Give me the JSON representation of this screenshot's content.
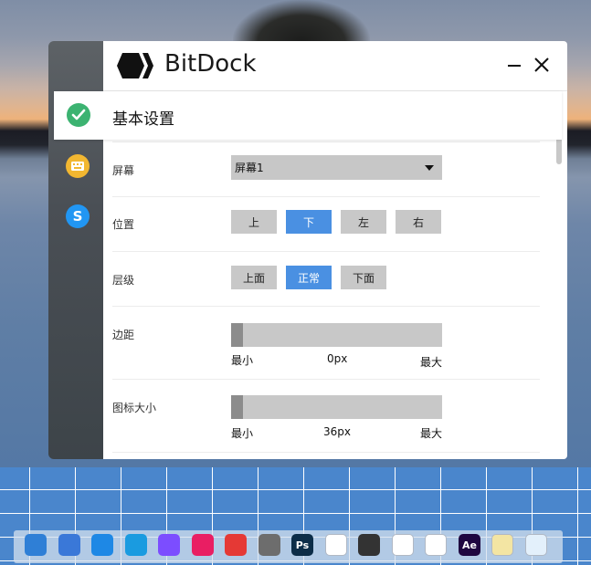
{
  "window": {
    "app_name": "BitDock"
  },
  "nav": {
    "active_tab": "基本设置"
  },
  "settings": {
    "screen": {
      "label": "屏幕",
      "value": "屏幕1"
    },
    "position": {
      "label": "位置",
      "options": [
        "上",
        "下",
        "左",
        "右"
      ],
      "selected": "下"
    },
    "layer": {
      "label": "层级",
      "options": [
        "上面",
        "正常",
        "下面"
      ],
      "selected": "正常"
    },
    "margin": {
      "label": "边距",
      "min_label": "最小",
      "value_label": "0px",
      "max_label": "最大"
    },
    "icon_size": {
      "label": "图标大小",
      "min_label": "最小",
      "value_label": "36px",
      "max_label": "最大"
    }
  },
  "dock_apps": [
    {
      "name": "finder-like-icon",
      "label": "",
      "color": "#2f7fd6"
    },
    {
      "name": "launchpad-icon",
      "label": "",
      "color": "#3a78d8"
    },
    {
      "name": "settings-gear-icon",
      "label": "",
      "color": "#1e88e5"
    },
    {
      "name": "search-app-icon",
      "label": "",
      "color": "#1a9be0"
    },
    {
      "name": "feedback-app-icon",
      "label": "",
      "color": "#7c4dff"
    },
    {
      "name": "crop-tool-icon",
      "label": "",
      "color": "#e91e63"
    },
    {
      "name": "screen-recorder-icon",
      "label": "",
      "color": "#e53935"
    },
    {
      "name": "notes-app-icon",
      "label": "",
      "color": "#6d6d6d"
    },
    {
      "name": "photoshop-icon",
      "label": "Ps",
      "color": "#0c2d48"
    },
    {
      "name": "baidu-netdisk-icon",
      "label": "",
      "color": "#ffffff"
    },
    {
      "name": "windows-app-icon",
      "label": "",
      "color": "#333333"
    },
    {
      "name": "chrome-icon",
      "label": "",
      "color": "#ffffff"
    },
    {
      "name": "opera-icon",
      "label": "",
      "color": "#ffffff"
    },
    {
      "name": "after-effects-icon",
      "label": "Ae",
      "color": "#1f0740"
    },
    {
      "name": "memo-app-icon",
      "label": "",
      "color": "#f3e5a3"
    },
    {
      "name": "recycle-bin-icon",
      "label": "",
      "color": "#e3f0fb"
    }
  ]
}
